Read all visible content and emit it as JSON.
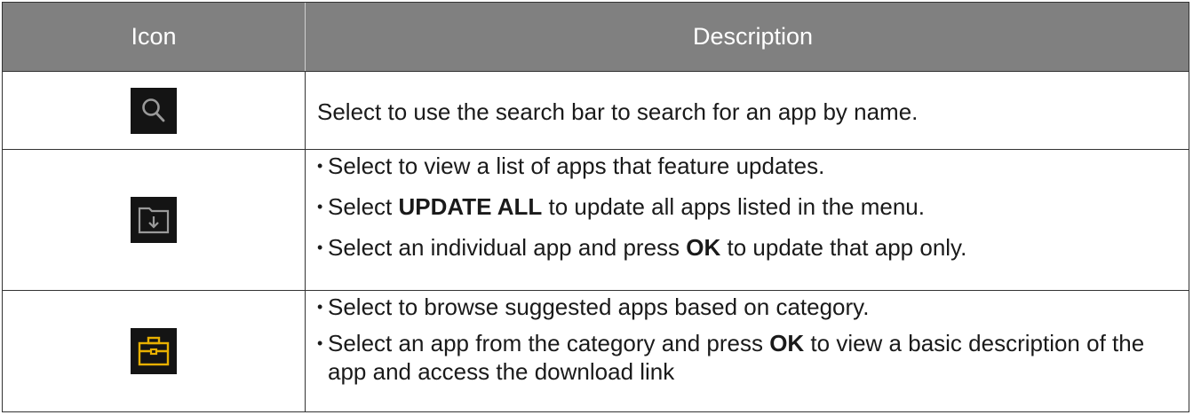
{
  "table": {
    "headers": {
      "icon": "Icon",
      "description": "Description"
    },
    "rows": [
      {
        "icon_name": "search-icon",
        "text": "Select to use the search bar to search for an app by name."
      },
      {
        "icon_name": "folder-download-icon",
        "bullets": [
          {
            "pre": "Select to view a list of apps that feature updates.",
            "bold": "",
            "post": ""
          },
          {
            "pre": "Select ",
            "bold": "UPDATE ALL",
            "post": " to update all apps listed in the menu."
          },
          {
            "pre": "Select an individual app and press ",
            "bold": "OK",
            "post": " to update that app only."
          }
        ]
      },
      {
        "icon_name": "briefcase-icon",
        "bullets": [
          {
            "pre": "Select to browse suggested apps based on category.",
            "bold": "",
            "post": ""
          },
          {
            "pre": "Select an app from the category and press ",
            "bold": "OK",
            "post": " to view a basic description of the app and access the download link"
          }
        ]
      }
    ]
  },
  "colors": {
    "header_bg": "#808080",
    "header_text": "#ffffff",
    "icon_dark": "#141414",
    "briefcase": "#e8b000",
    "icon_stroke": "#9a9a9a"
  }
}
